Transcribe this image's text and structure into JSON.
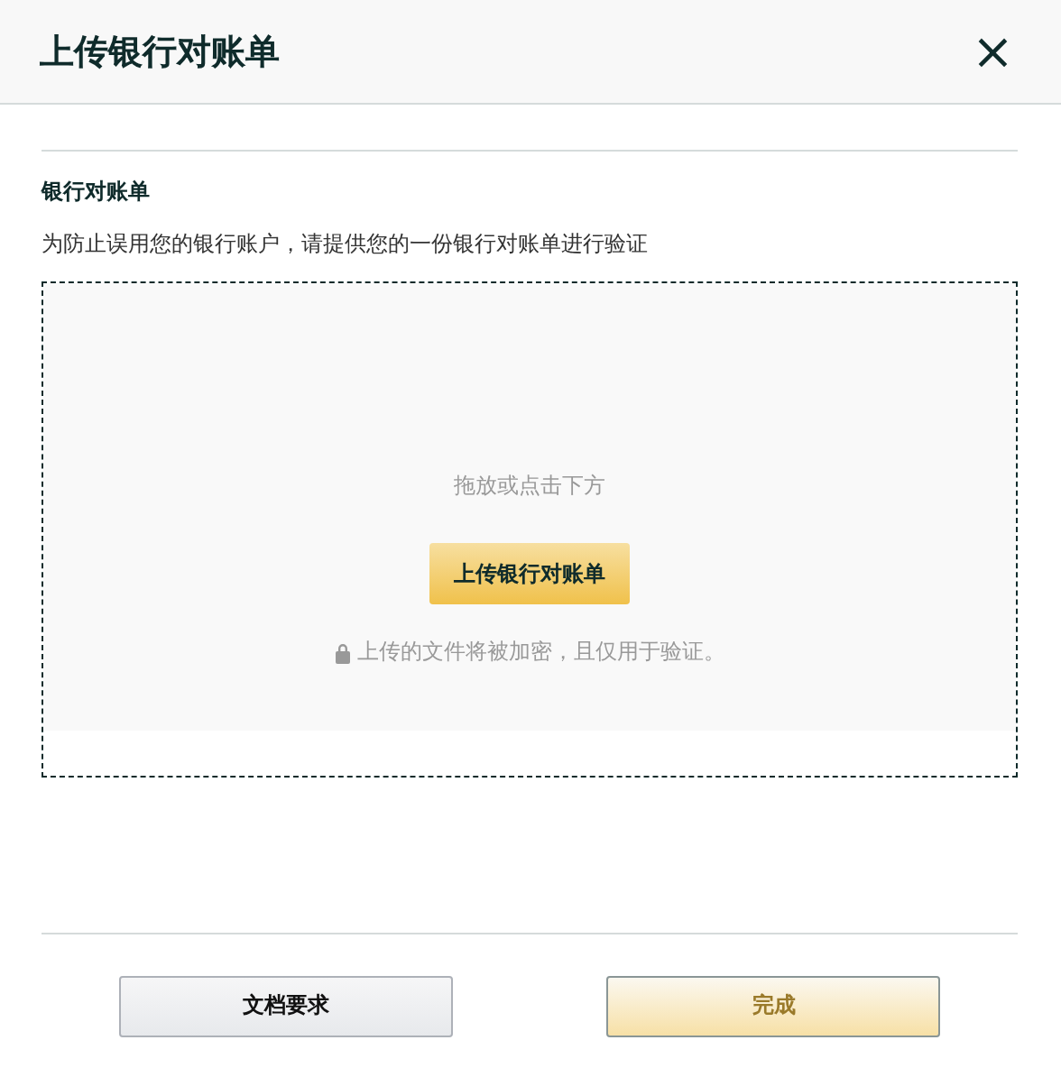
{
  "dialog": {
    "title": "上传银行对账单",
    "close": "×"
  },
  "section": {
    "title": "银行对账单",
    "description": "为防止误用您的银行账户，请提供您的一份银行对账单进行验证"
  },
  "dropzone": {
    "hint": "拖放或点击下方",
    "button": "上传银行对账单",
    "note": "上传的文件将被加密，且仅用于验证。"
  },
  "buttons": [
    {
      "label": "文档要求",
      "kind": "secondary",
      "disabled": false
    },
    {
      "label": "完成",
      "kind": "primary",
      "disabled": true
    }
  ]
}
